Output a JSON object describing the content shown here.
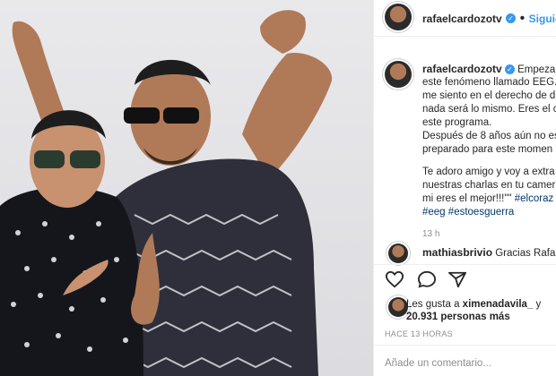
{
  "header": {
    "username": "rafaelcardozotv",
    "follow_label": "Siguiend"
  },
  "caption": {
    "username": "rafaelcardozotv",
    "lines": [
      "Empezam",
      "este fenómeno llamado EEG.",
      "me siento en el derecho de d",
      "nada será lo mismo. Eres el c",
      "este programa.",
      "Después de 8 años aún no es",
      "preparado para este momen",
      "",
      "Te adoro amigo y voy a extra",
      "nuestras charlas en tu camer",
      "mi eres el mejor!!!\"\""
    ],
    "hashtag_inline": "#elcoraz",
    "hashtags": [
      "#eeg",
      "#estoesguerra"
    ],
    "time": "13 h"
  },
  "comment": {
    "username": "mathiasbrivio",
    "text": "Gracias Rafa"
  },
  "likes": {
    "prefix": "Les gusta a",
    "user": "ximenadavila_",
    "connector": "y",
    "count": "20.931 personas más"
  },
  "timestamp": "HACE 13 HORAS",
  "comment_placeholder": "Añade un comentario...",
  "icons": {
    "like": "heart-icon",
    "comment": "comment-icon",
    "share": "share-icon",
    "verified": "verified-badge-icon"
  },
  "colors": {
    "link": "#3897f0",
    "hashtag": "#00376b",
    "muted": "#8e8e8e"
  }
}
